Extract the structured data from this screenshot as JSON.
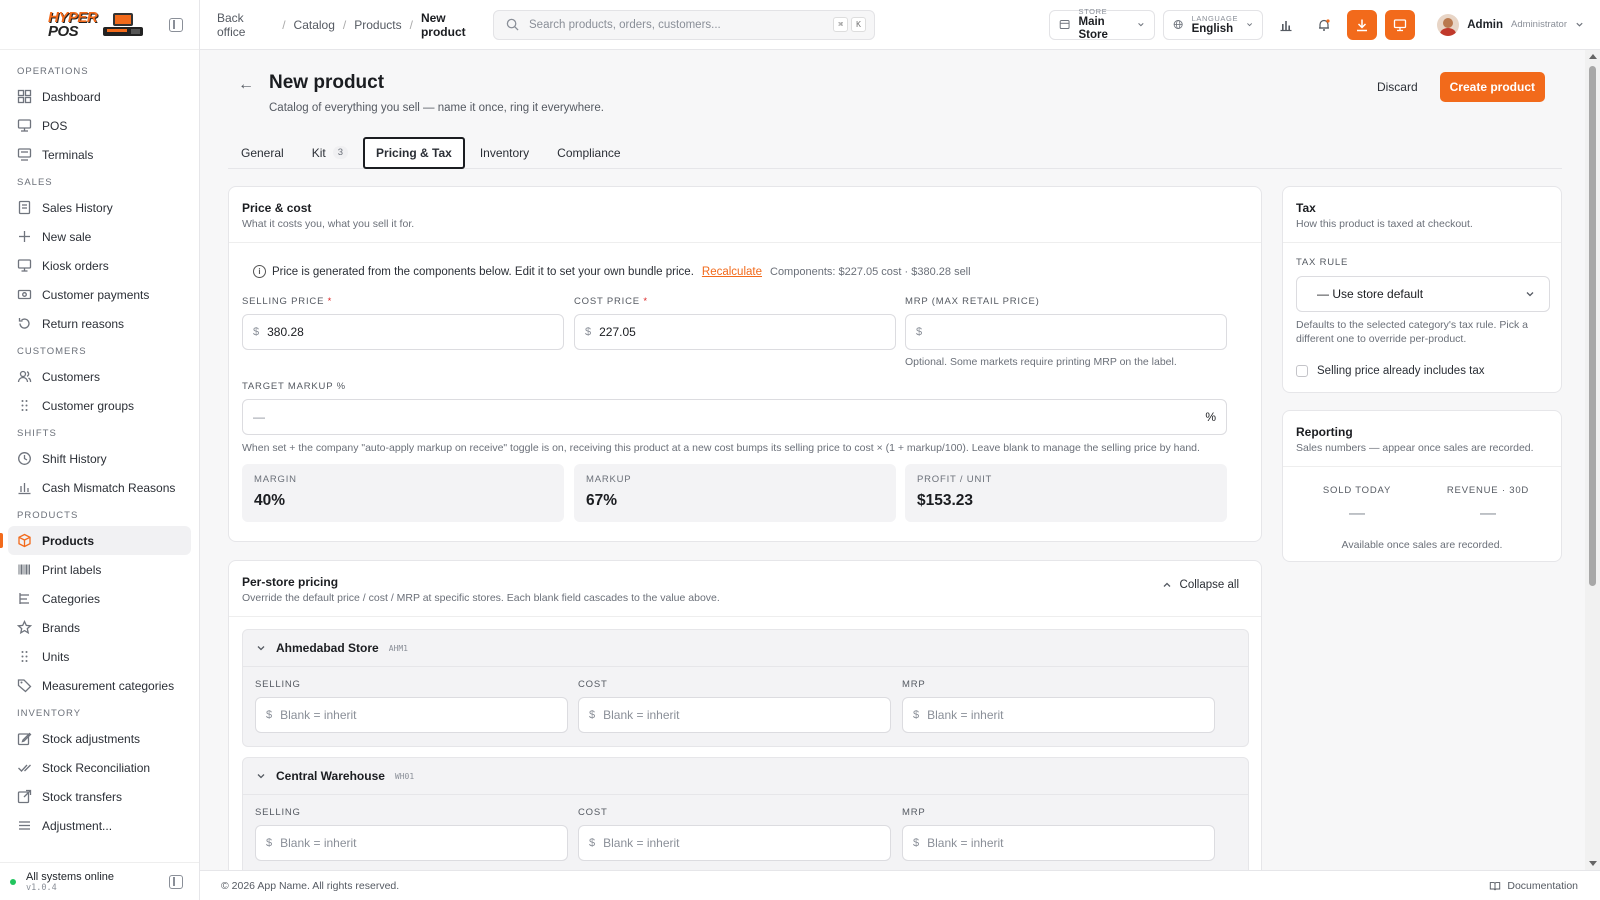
{
  "app": {
    "logo_line1": "HYPER",
    "logo_line2": "POS"
  },
  "sidebar": {
    "sections": [
      {
        "title": "OPERATIONS",
        "items": [
          {
            "label": "Dashboard",
            "icon": "dashboard-icon"
          },
          {
            "label": "POS",
            "icon": "pos-terminal-icon"
          },
          {
            "label": "Terminals",
            "icon": "terminal-icon"
          }
        ]
      },
      {
        "title": "SALES",
        "items": [
          {
            "label": "Sales History",
            "icon": "receipt-icon"
          },
          {
            "label": "New sale",
            "icon": "plus-icon"
          },
          {
            "label": "Kiosk orders",
            "icon": "kiosk-icon"
          },
          {
            "label": "Customer payments",
            "icon": "payment-icon"
          },
          {
            "label": "Return reasons",
            "icon": "return-icon"
          }
        ]
      },
      {
        "title": "CUSTOMERS",
        "items": [
          {
            "label": "Customers",
            "icon": "users-icon"
          },
          {
            "label": "Customer groups",
            "icon": "grip-icon"
          }
        ]
      },
      {
        "title": "SHIFTS",
        "items": [
          {
            "label": "Shift History",
            "icon": "clock-icon"
          },
          {
            "label": "Cash Mismatch Reasons",
            "icon": "bar-chart-icon"
          }
        ]
      },
      {
        "title": "PRODUCTS",
        "items": [
          {
            "label": "Products",
            "icon": "box-icon",
            "active": true
          },
          {
            "label": "Print labels",
            "icon": "barcode-icon"
          },
          {
            "label": "Categories",
            "icon": "categories-icon"
          },
          {
            "label": "Brands",
            "icon": "star-icon"
          },
          {
            "label": "Units",
            "icon": "grip-icon"
          },
          {
            "label": "Measurement categories",
            "icon": "tag-icon"
          }
        ]
      },
      {
        "title": "INVENTORY",
        "items": [
          {
            "label": "Stock adjustments",
            "icon": "edit-icon"
          },
          {
            "label": "Stock Reconciliation",
            "icon": "check-double-icon"
          },
          {
            "label": "Stock transfers",
            "icon": "external-link-icon"
          },
          {
            "label": "Adjustment...",
            "icon": "list-icon"
          }
        ]
      }
    ],
    "footer": {
      "status": "All systems online",
      "version": "v1.0.4"
    }
  },
  "topbar": {
    "breadcrumb": [
      "Back office",
      "Catalog",
      "Products",
      "New product"
    ],
    "search_placeholder": "Search products, orders, customers...",
    "kbd": [
      "⌘",
      "K"
    ],
    "store_label": "STORE",
    "store_value": "Main Store",
    "language_label": "LANGUAGE",
    "language_value": "English",
    "user_name": "Admin",
    "user_role": "Administrator"
  },
  "page": {
    "title": "New product",
    "subtitle": "Catalog of everything you sell — name it once, ring it everywhere.",
    "discard_label": "Discard",
    "create_label": "Create product",
    "tabs": [
      {
        "label": "General"
      },
      {
        "label": "Kit",
        "count": "3"
      },
      {
        "label": "Pricing & Tax",
        "active": true
      },
      {
        "label": "Inventory"
      },
      {
        "label": "Compliance"
      }
    ]
  },
  "price_cost": {
    "title": "Price & cost",
    "desc": "What it costs you, what you sell it for.",
    "notice": "Price is generated from the components below. Edit it to set your own bundle price.",
    "recalculate": "Recalculate",
    "components": "Components: $227.05 cost · $380.28 sell",
    "selling_label": "SELLING PRICE",
    "selling_value": "380.28",
    "cost_label": "COST PRICE",
    "cost_value": "227.05",
    "mrp_label": "MRP (MAX RETAIL PRICE)",
    "mrp_value": "",
    "mrp_help": "Optional. Some markets require printing MRP on the label.",
    "currency": "$",
    "required_mark": "*",
    "markup_label": "TARGET MARKUP %",
    "markup_placeholder": "—",
    "markup_suffix": "%",
    "markup_help": "When set + the company \"auto-apply markup on receive\" toggle is on, receiving this product at a new cost bumps its selling price to cost × (1 + markup/100). Leave blank to manage the selling price by hand.",
    "stats": [
      {
        "label": "MARGIN",
        "value": "40%"
      },
      {
        "label": "MARKUP",
        "value": "67%"
      },
      {
        "label": "PROFIT / UNIT",
        "value": "$153.23"
      }
    ]
  },
  "per_store": {
    "title": "Per-store pricing",
    "desc": "Override the default price / cost / MRP at specific stores. Each blank field cascades to the value above.",
    "collapse_label": "Collapse all",
    "field_labels": [
      "SELLING",
      "COST",
      "MRP"
    ],
    "placeholder": "Blank = inherit",
    "stores": [
      {
        "name": "Ahmedabad Store",
        "code": "AHM1"
      },
      {
        "name": "Central Warehouse",
        "code": "WH01"
      }
    ]
  },
  "tax": {
    "title": "Tax",
    "desc": "How this product is taxed at checkout.",
    "rule_label": "TAX RULE",
    "rule_value": "— Use store default",
    "help": "Defaults to the selected category's tax rule. Pick a different one to override per-product.",
    "includes_tax_label": "Selling price already includes tax"
  },
  "reporting": {
    "title": "Reporting",
    "desc": "Sales numbers — appear once sales are recorded.",
    "sold_label": "SOLD TODAY",
    "sold_value": "—",
    "revenue_label": "REVENUE · 30D",
    "revenue_value": "—",
    "note": "Available once sales are recorded."
  },
  "footer": {
    "copyright": "© 2026 App Name. All rights reserved.",
    "docs": "Documentation"
  },
  "colors": {
    "accent": "#f26a1b",
    "online": "#22c55e",
    "required": "#dc2626"
  }
}
